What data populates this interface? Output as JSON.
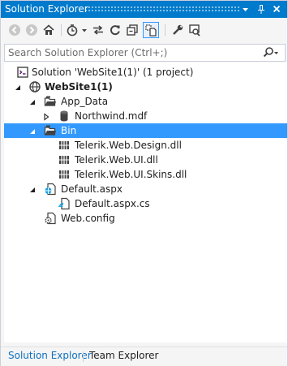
{
  "window": {
    "title": "Solution Explorer"
  },
  "title_controls": {
    "dropdown_icon": "dropdown-arrow-icon",
    "pin_icon": "pin-icon",
    "close_icon": "close-icon"
  },
  "toolbar": {
    "buttons": [
      "back-icon",
      "forward-icon",
      "home-icon",
      "pending-changes-filter-icon",
      "sync-with-active-document-icon",
      "refresh-icon",
      "collapse-all-icon",
      "show-all-files-icon",
      "properties-icon",
      "preview-selected-items-icon"
    ]
  },
  "search": {
    "placeholder": "Search Solution Explorer (Ctrl+;)",
    "value": ""
  },
  "tree": {
    "solution": "Solution 'WebSite1(1)' (1 project)",
    "website": "WebSite1(1)",
    "app_data": "App_Data",
    "northwind": "Northwind.mdf",
    "bin": "Bin",
    "dll1": "Telerik.Web.Design.dll",
    "dll2": "Telerik.Web.UI.dll",
    "dll3": "Telerik.Web.UI.Skins.dll",
    "default_aspx": "Default.aspx",
    "default_cs": "Default.aspx.cs",
    "web_config": "Web.config",
    "selected": "Bin"
  },
  "tabs": {
    "solution_explorer": "Solution Explorer",
    "team_explorer": "Team Explorer",
    "active": "Solution Explorer"
  },
  "colors": {
    "accent": "#007acc",
    "selection": "#3399ff",
    "active_tab": "#0e70c0"
  }
}
